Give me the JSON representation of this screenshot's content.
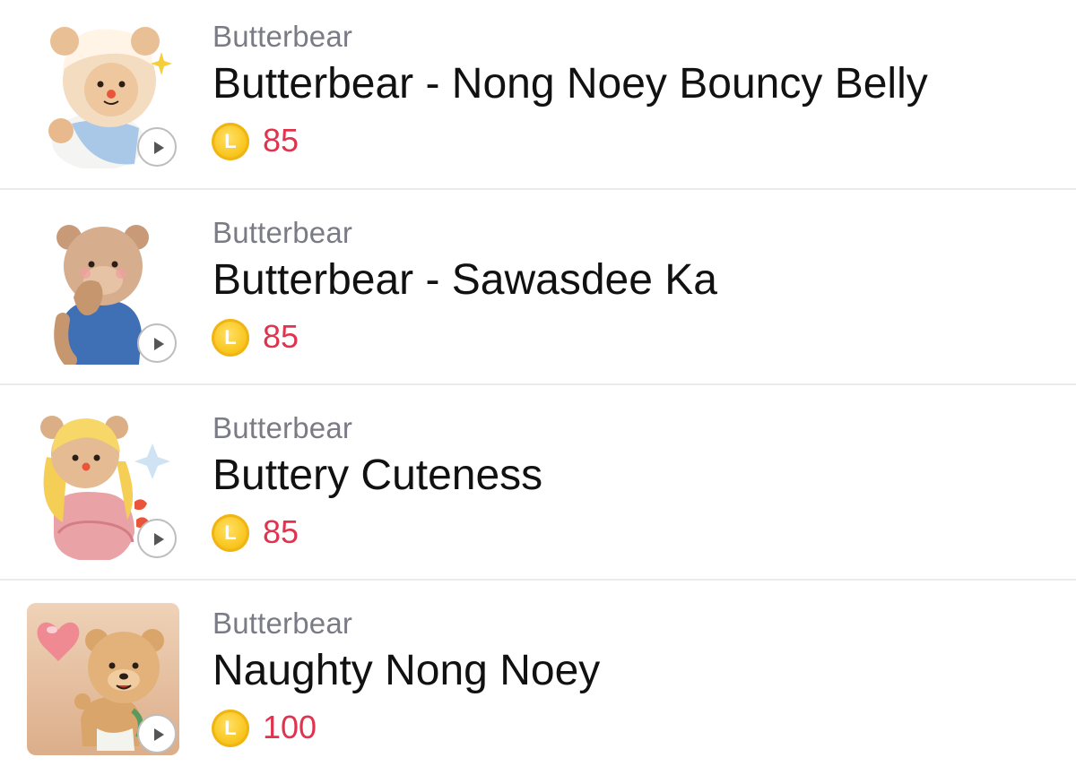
{
  "items": [
    {
      "author": "Butterbear",
      "title": "Butterbear - Nong Noey Bouncy Belly",
      "price": "85",
      "coin_symbol": "L",
      "thumbnail": "bear-with-bonnet-sparkle",
      "play_icon": "play-icon"
    },
    {
      "author": "Butterbear",
      "title": "Butterbear - Sawasdee Ka",
      "price": "85",
      "coin_symbol": "L",
      "thumbnail": "bear-in-blue-overalls",
      "play_icon": "play-icon"
    },
    {
      "author": "Butterbear",
      "title": "Buttery Cuteness",
      "price": "85",
      "coin_symbol": "L",
      "thumbnail": "bear-with-blonde-hair",
      "play_icon": "play-icon"
    },
    {
      "author": "Butterbear",
      "title": "Naughty Nong Noey",
      "price": "100",
      "coin_symbol": "L",
      "thumbnail": "bear-with-heart-balloon",
      "play_icon": "play-icon"
    }
  ],
  "colors": {
    "author": "#7b7b85",
    "title": "#111111",
    "price": "#e0344e",
    "coin": "#f8c51c",
    "divider": "#ebebeb"
  }
}
